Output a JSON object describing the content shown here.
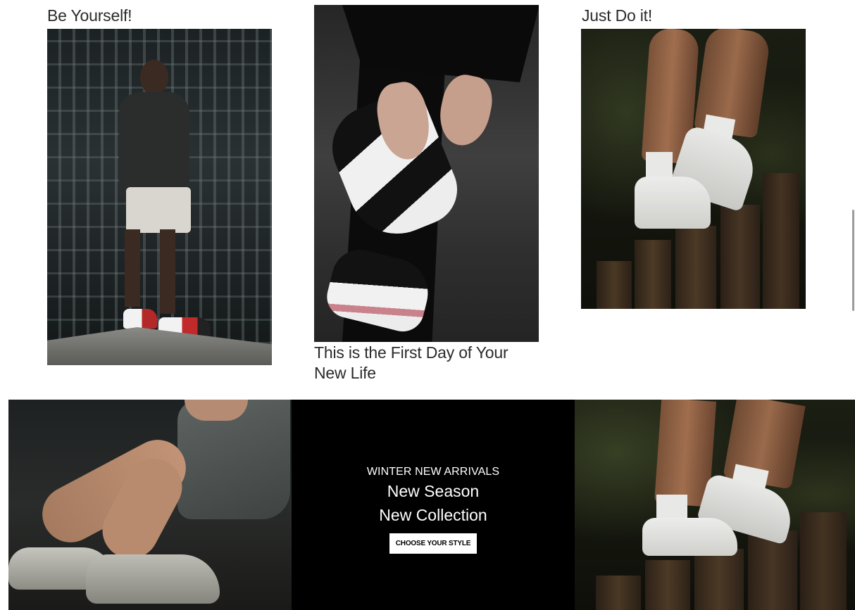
{
  "gallery": {
    "cards": [
      {
        "title": "Be Yourself!",
        "image": "man-standing-on-ledge-photo"
      },
      {
        "title": "This is the First Day of Your New Life",
        "image": "hands-tying-sneaker-photo"
      },
      {
        "title": "Just Do it!",
        "image": "white-sneakers-on-posts-photo"
      }
    ]
  },
  "banner": {
    "eyebrow": "WINTER NEW ARRIVALS",
    "heading_line1": "New Season",
    "heading_line2": "New Collection",
    "cta_label": "CHOOSE YOUR STYLE",
    "left_image": "woman-tying-shoes-photo",
    "right_image": "white-sneakers-on-posts-photo"
  },
  "colors": {
    "banner_background": "#000000",
    "cta_background": "#ffffff",
    "text_dark": "#2b2b2b"
  }
}
